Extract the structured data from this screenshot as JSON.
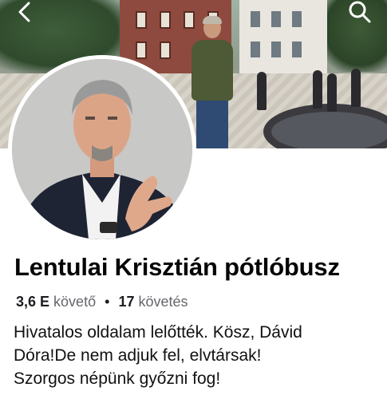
{
  "cover": {
    "back_icon": "chevron-left-icon",
    "search_icon": "search-icon"
  },
  "profile": {
    "name": "Lentulai Krisztián pótlóbusz",
    "followers_count": "3,6 E",
    "followers_label": "követő",
    "separator": "•",
    "following_count": "17",
    "following_label": "követés",
    "bio_lines": [
      "Hivatalos oldalam lelőtték. Kösz, Dávid",
      "Dóra!De nem adjuk fel, elvtársak!",
      "Szorgos népünk győzni fog!"
    ]
  },
  "colors": {
    "text_primary": "#050505",
    "text_secondary": "#65676b",
    "background": "#ffffff"
  }
}
